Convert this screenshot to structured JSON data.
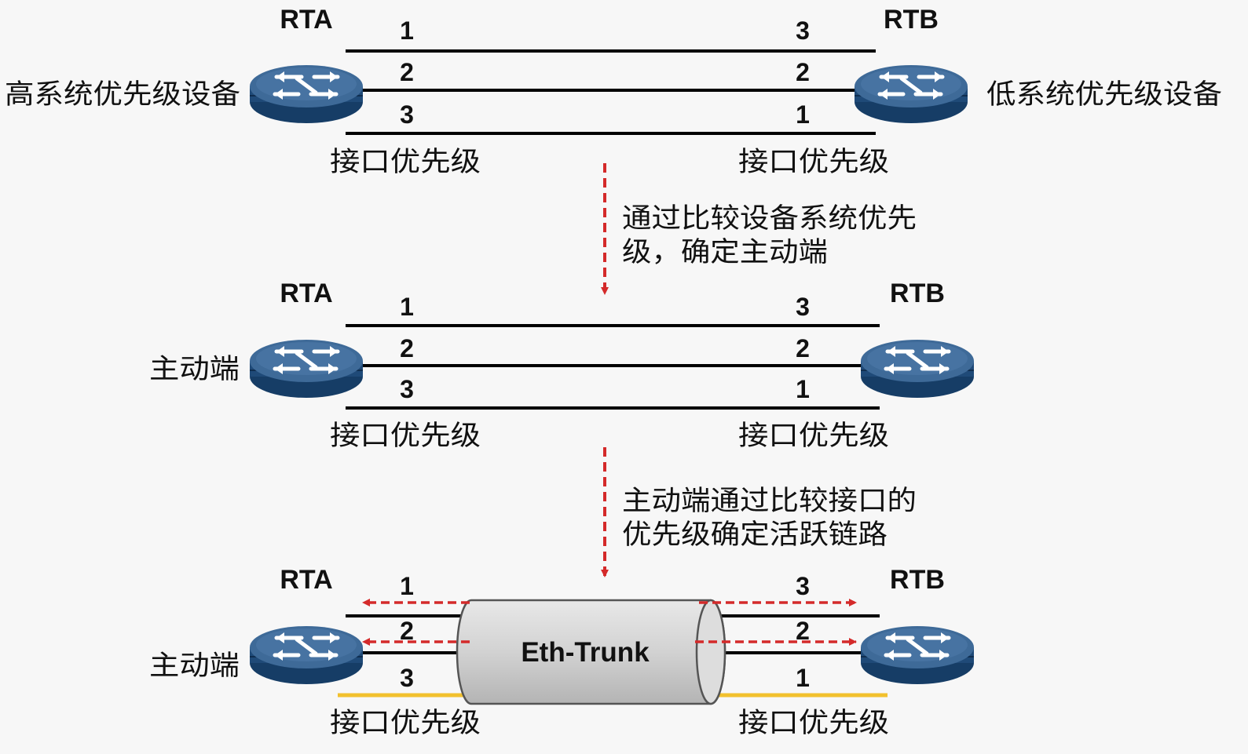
{
  "stage1": {
    "left_router": "RTA",
    "right_router": "RTB",
    "left_side_label": "高系统优先级设备",
    "right_side_label": "低系统优先级设备",
    "left_port_numbers": [
      "1",
      "2",
      "3"
    ],
    "right_port_numbers": [
      "3",
      "2",
      "1"
    ],
    "left_caption": "接口优先级",
    "right_caption": "接口优先级"
  },
  "arrow1": {
    "text_line1": "通过比较设备系统优先",
    "text_line2": "级，确定主动端"
  },
  "stage2": {
    "left_router": "RTA",
    "right_router": "RTB",
    "left_side_label": "主动端",
    "left_port_numbers": [
      "1",
      "2",
      "3"
    ],
    "right_port_numbers": [
      "3",
      "2",
      "1"
    ],
    "left_caption": "接口优先级",
    "right_caption": "接口优先级"
  },
  "arrow2": {
    "text_line1": "主动端通过比较接口的",
    "text_line2": "优先级确定活跃链路"
  },
  "stage3": {
    "left_router": "RTA",
    "right_router": "RTB",
    "left_side_label": "主动端",
    "left_port_numbers": [
      "1",
      "2",
      "3"
    ],
    "right_port_numbers": [
      "3",
      "2",
      "1"
    ],
    "left_caption": "接口优先级",
    "right_caption": "接口优先级",
    "trunk_label": "Eth-Trunk"
  },
  "colors": {
    "router_top": "#3e6a98",
    "router_side": "#1f4a78",
    "arrow": "#d42a2a",
    "inactive_link": "#f2c12e",
    "link": "#000000"
  },
  "icons": {
    "router": "router-icon"
  }
}
